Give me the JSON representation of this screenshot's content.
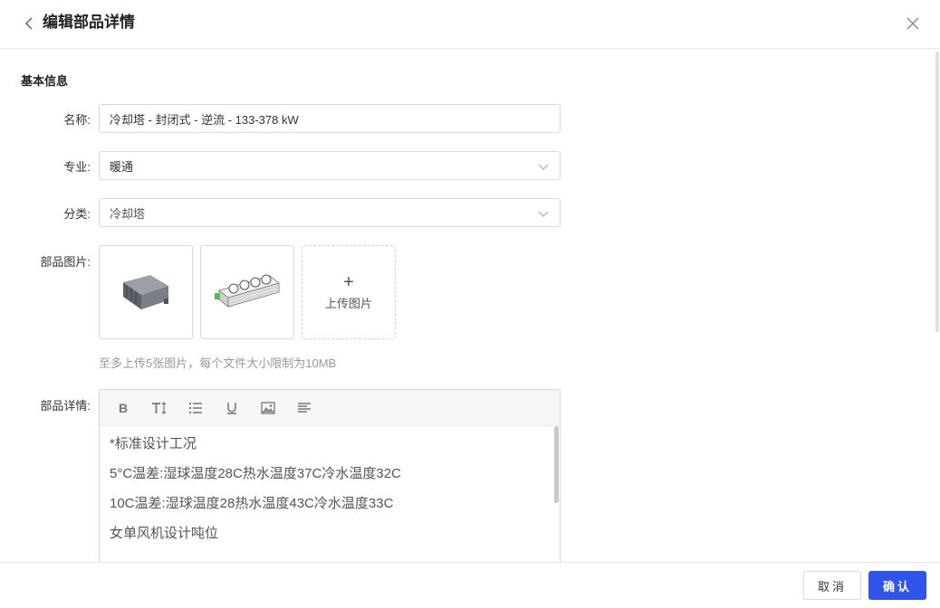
{
  "header": {
    "title": "编辑部品详情"
  },
  "section": {
    "title": "基本信息"
  },
  "form": {
    "name_label": "名称:",
    "name_value": "冷却塔 - 封闭式 - 逆流 - 133-378 kW",
    "discipline_label": "专业:",
    "discipline_value": "暖通",
    "category_label": "分类:",
    "category_value": "冷却塔",
    "images_label": "部品图片:",
    "upload_label": "上传图片",
    "upload_hint": "至多上传5张图片，每个文件大小限制为10MB",
    "details_label": "部品详情:"
  },
  "editor": {
    "toolbar": {
      "bold_label": "B"
    },
    "lines": [
      "*标准设计工况",
      "5°C温差:湿球温度28C热水温度37C冷水温度32C",
      "10C温差:湿球温度28热水温度43C冷水温度33C",
      "女单风机设计吨位"
    ]
  },
  "footer": {
    "cancel_label": "取消",
    "confirm_label": "确认"
  },
  "colors": {
    "primary": "#2f54eb",
    "border": "#d9d9d9",
    "hint": "#999999"
  }
}
